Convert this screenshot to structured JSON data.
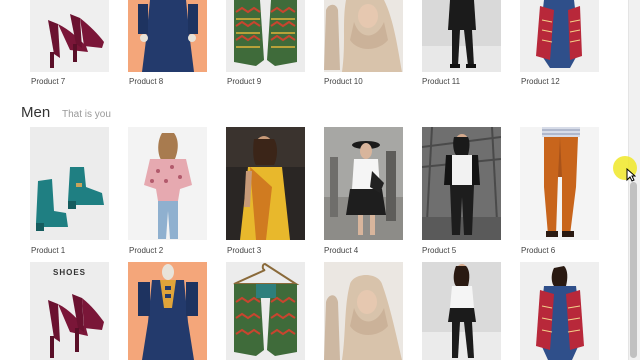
{
  "row_top": {
    "captions": [
      "Product 7",
      "Product 8",
      "Product 9",
      "Product 10",
      "Product 11",
      "Product 12"
    ]
  },
  "section": {
    "title": "Men",
    "subtitle": "That is you"
  },
  "row_middle": {
    "captions": [
      "Product 1",
      "Product 2",
      "Product 3",
      "Product 4",
      "Product 5",
      "Product 6"
    ]
  },
  "row_bottom": {
    "shoes_label": "SHOES"
  },
  "colors": {
    "accent_cursor": "#f0e828",
    "teal_boot": "#1f7f82",
    "maroon_heel": "#6b1230",
    "navy_dress": "#233a6c",
    "orange_bg": "#f4a67a"
  }
}
